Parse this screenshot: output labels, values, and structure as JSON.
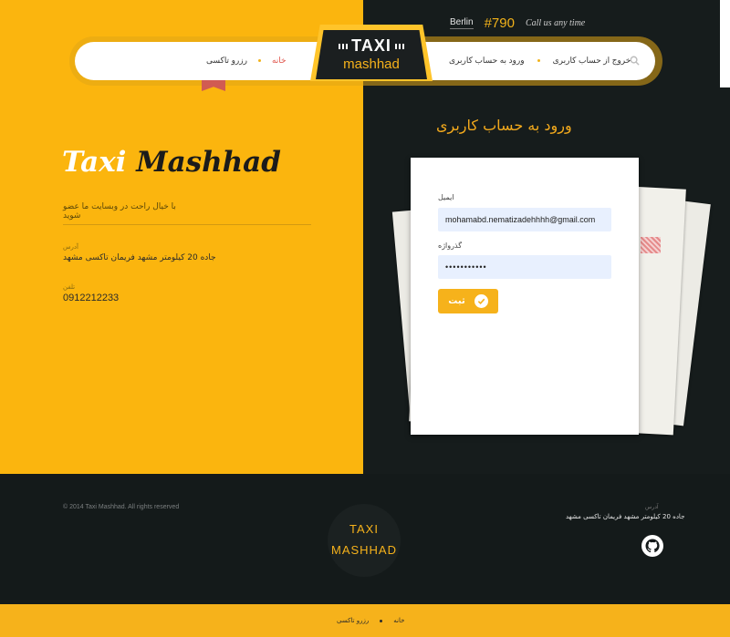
{
  "header": {
    "city": "Berlin",
    "phone": "#790",
    "call_text": "Call us any time"
  },
  "nav": {
    "left_items": [
      "خانه",
      "رزرو تاکسی"
    ],
    "right_items": [
      "ورود به حساب کاربری",
      "خروج از حساب کاربری"
    ]
  },
  "logo": {
    "taxi": "TAXI",
    "city": "mashhad"
  },
  "hero": {
    "title_word1": "Taxi",
    "title_word2": "Mashhad",
    "tagline": "با خیال راحت در وبسایت ما عضو شوید",
    "address_label": "آدرس",
    "address": "جاده 20 کیلومتر مشهد فریمان تاکسی مشهد",
    "phone_label": "تلفن",
    "phone": "0912212233"
  },
  "login": {
    "title": "ورود به حساب کاربری",
    "email_label": "ایمیل",
    "email_value": "mohamabd.nematizadehhhh@gmail.com",
    "password_label": "گذرواژه",
    "password_value": "•••••••••••",
    "submit_label": "ثبت"
  },
  "footer": {
    "copyright": "© 2014 Taxi Mashhad. All rights reserved",
    "logo_line1": "TAXI",
    "logo_line2": "MASHHAD",
    "address_label": "آدرس",
    "address": "جاده 20 کیلومتر مشهد فریمان تاکسی مشهد"
  },
  "bottom_nav": [
    "خانه",
    "رزرو تاکسی"
  ],
  "colors": {
    "accent": "#fbb50e",
    "dark": "#161c1c",
    "nav_home": "#e0534a"
  }
}
